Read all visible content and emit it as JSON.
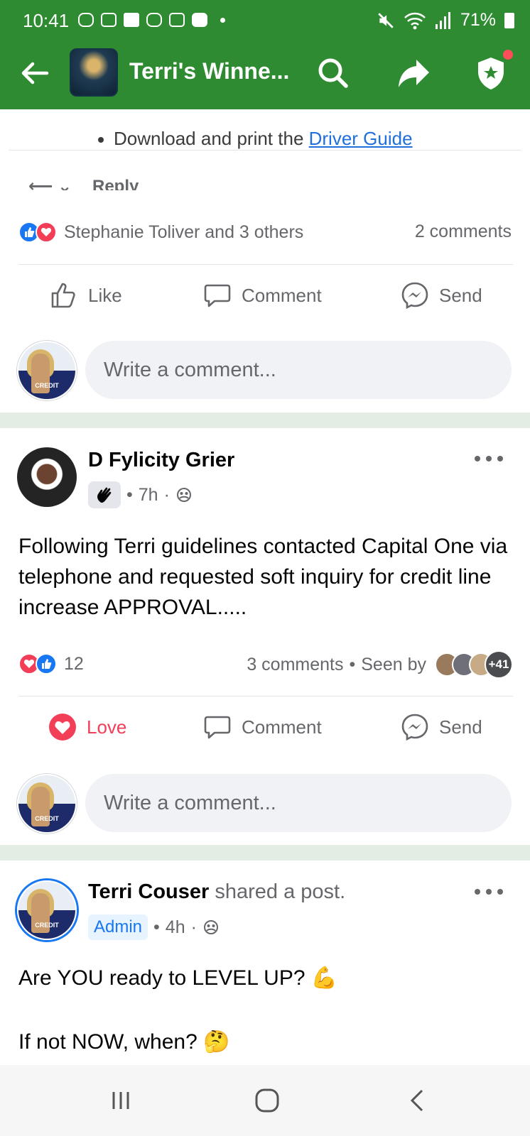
{
  "status_bar": {
    "time": "10:41",
    "battery": "71%"
  },
  "header": {
    "group_title": "Terri's Winne...",
    "accent_color": "#2e8b31"
  },
  "previous_post": {
    "bullet_text": "Download and print the ",
    "bullet_link": "Driver Guide",
    "reply_peek": "Reply",
    "reactions_text": "Stephanie Toliver and 3 others",
    "comments_count": "2 comments",
    "actions": {
      "like": "Like",
      "comment": "Comment",
      "send": "Send"
    },
    "comment_placeholder": "Write a comment..."
  },
  "post1": {
    "author": "D Fylicity Grier",
    "time": "7h",
    "text": "Following Terri guidelines contacted Capital One via telephone and requested soft inquiry for credit line increase APPROVAL.....",
    "reaction_count": "12",
    "comments_count": "3 comments",
    "seen_by": "Seen by",
    "seen_more": "+41",
    "actions": {
      "love": "Love",
      "comment": "Comment",
      "send": "Send"
    },
    "comment_placeholder": "Write a comment..."
  },
  "post2": {
    "author": "Terri Couser",
    "action": " shared a post.",
    "badge": "Admin",
    "time": "4h",
    "line1": "Are YOU ready to LEVEL UP? 💪",
    "line2": "If not NOW, when? 🤔"
  }
}
